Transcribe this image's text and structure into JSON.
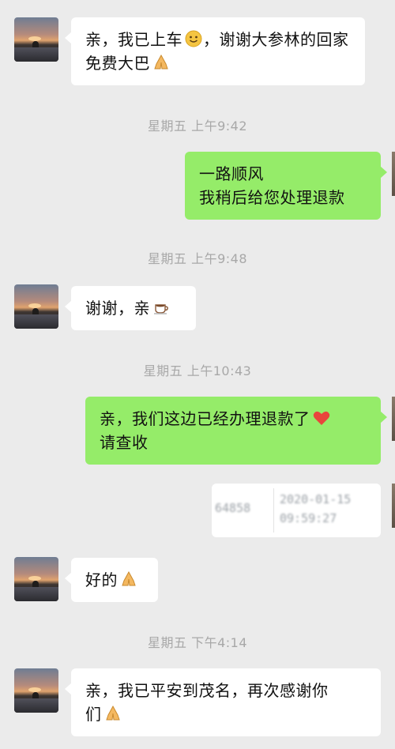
{
  "messages": {
    "m1": "亲，我已上车",
    "m1_tail": "，谢谢大参林的回家免费大巴",
    "ts1": "星期五 上午9:42",
    "m2_line1": "一路顺风",
    "m2_line2": "我稍后给您处理退款",
    "ts2": "星期五 上午9:48",
    "m3": "谢谢，亲",
    "ts3": "星期五 上午10:43",
    "m4_line1": "亲，我们这边已经办理退款了",
    "m4_line2": "请查收",
    "transfer_id": "64858",
    "transfer_date": "2020-01-15",
    "transfer_time": "09:59:27",
    "m5": "好的",
    "ts4": "星期五 下午4:14",
    "m6_line1": "亲，我已平安到茂名，再次感谢你",
    "m6_line2": "们"
  },
  "icons": {
    "smile": "smiling-face-emoji",
    "pray": "folded-hands-emoji",
    "coffee": "coffee-emoji",
    "heart": "red-heart-emoji"
  },
  "colors": {
    "background": "#ebebeb",
    "bubble_left": "#ffffff",
    "bubble_right": "#95ec69",
    "timestamp": "#a8a8a8"
  }
}
